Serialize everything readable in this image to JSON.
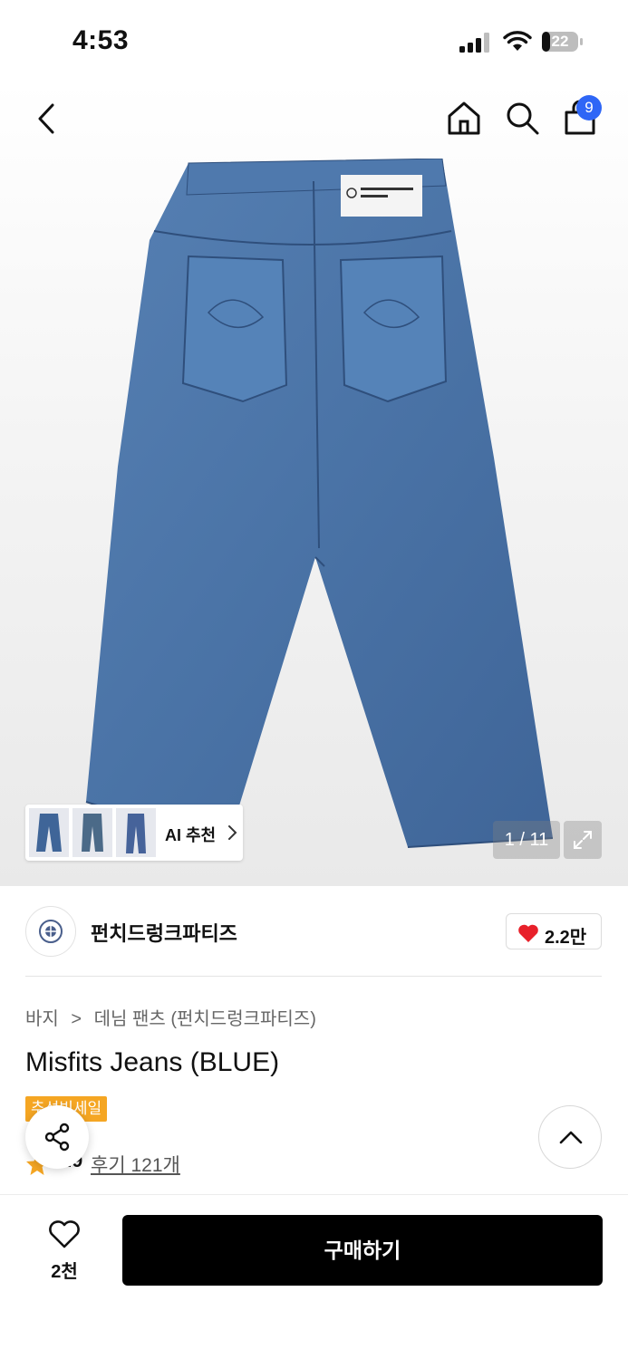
{
  "status_bar": {
    "time": "4:53",
    "battery": "22"
  },
  "nav": {
    "cart_count": "9"
  },
  "gallery": {
    "ai_label": "AI 추천",
    "counter": "1 / 11",
    "jeans_color": "#4a73a6"
  },
  "brand": {
    "name": "펀치드렁크파티즈",
    "likes": "2.2만"
  },
  "product": {
    "breadcrumb": [
      "바지",
      "데님 팬츠 (펀치드렁크파티즈)"
    ],
    "title": "Misfits Jeans (BLUE)",
    "sale_badge": "추석빅세일",
    "rating": "4.9",
    "reviews": "후기 121개"
  },
  "bottom": {
    "wish_count": "2천",
    "buy_label": "구매하기"
  },
  "colors": {
    "accent_blue": "#2e66f6",
    "sale_orange": "#f5a623",
    "heart_red": "#e8202a",
    "star": "#f5a623"
  }
}
